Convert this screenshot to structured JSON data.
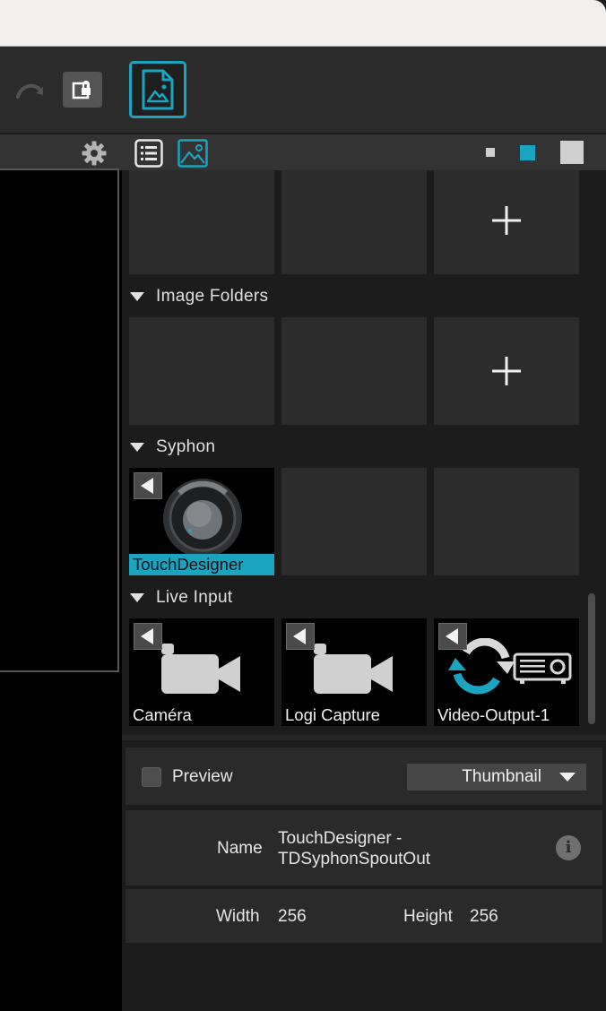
{
  "browser": {
    "sections": [
      {
        "label": "Image Folders"
      },
      {
        "label": "Syphon"
      },
      {
        "label": "Live Input"
      }
    ],
    "syphon_tile": {
      "label": "TouchDesigner",
      "selected": true
    },
    "live_inputs": [
      {
        "label": "Caméra"
      },
      {
        "label": "Logi Capture"
      },
      {
        "label": "Video-Output-1"
      }
    ]
  },
  "properties": {
    "preview_label": "Preview",
    "preview_checked": false,
    "preview_mode": "Thumbnail",
    "name_label": "Name",
    "name_line1": "TouchDesigner -",
    "name_line2": "TDSyphonSpoutOut",
    "width_label": "Width",
    "width_value": "256",
    "height_label": "Height",
    "height_value": "256"
  },
  "icons": {
    "toolbar": [
      "redo-icon",
      "lock-icon",
      "image-document-icon"
    ],
    "left_header": [
      "gear-icon"
    ],
    "right_header": [
      "list-view-icon",
      "image-view-icon"
    ],
    "info": "info-icon"
  },
  "colors": {
    "accent": "#1aa4c0",
    "panel": "#1c1c1c",
    "tile": "#2c2c2c",
    "header": "#333333"
  }
}
